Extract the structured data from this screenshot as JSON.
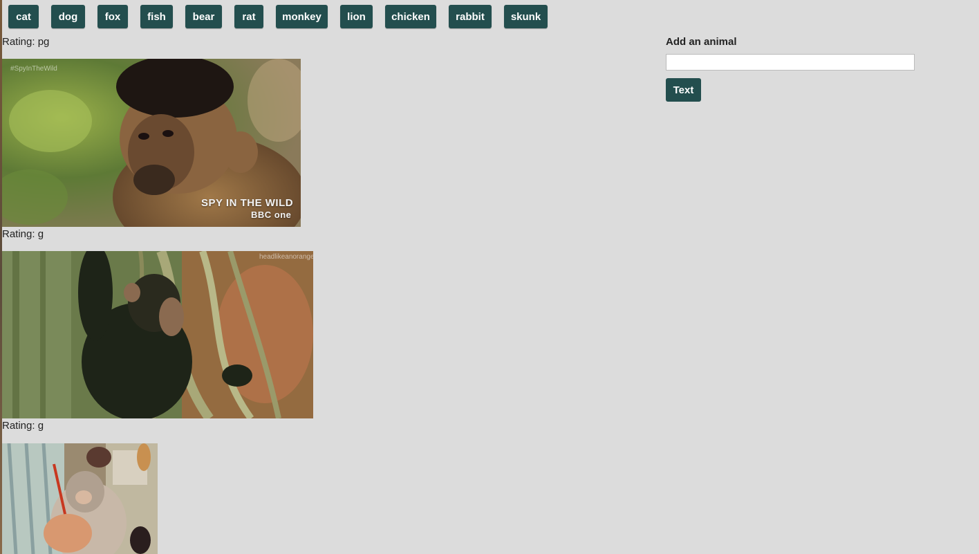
{
  "animal_buttons": [
    "cat",
    "dog",
    "fox",
    "fish",
    "bear",
    "rat",
    "monkey",
    "lion",
    "chicken",
    "rabbit",
    "skunk"
  ],
  "results": [
    {
      "rating": "Rating: pg",
      "image_alt": "capuchin monkey gif",
      "caption": "SPY IN THE WILD",
      "network": "BBC one",
      "hashtag": "#SpyInTheWild"
    },
    {
      "rating": "Rating: g",
      "image_alt": "young chimpanzee climbing vine gif",
      "hashtag": "headlikeanorange"
    },
    {
      "rating": "Rating: g",
      "image_alt": "monkey being brushed gif"
    }
  ],
  "add_form": {
    "label": "Add an animal",
    "input_value": "",
    "input_placeholder": "",
    "submit_label": "Text"
  },
  "colors": {
    "background": "#dcdcdc",
    "button": "#234e4e",
    "button_text": "#ffffff"
  }
}
